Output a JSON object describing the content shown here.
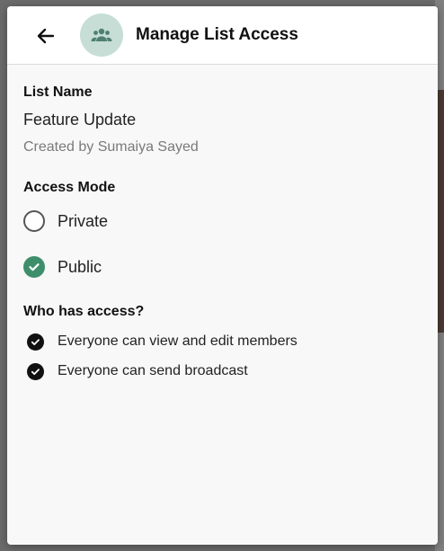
{
  "header": {
    "title": "Manage List Access",
    "back_icon": "arrow-left-icon",
    "avatar_icon": "group-icon",
    "avatar_bg": "#c6ded6"
  },
  "list": {
    "name_label": "List Name",
    "name_value": "Feature Update",
    "created_by": "Created by Sumaiya Sayed"
  },
  "access": {
    "label": "Access Mode",
    "options": [
      {
        "label": "Private",
        "selected": false
      },
      {
        "label": "Public",
        "selected": true
      }
    ],
    "selected_color": "#3e8e6c"
  },
  "permissions": {
    "label": "Who has access?",
    "items": [
      "Everyone can view and edit members",
      "Everyone can send broadcast"
    ]
  }
}
